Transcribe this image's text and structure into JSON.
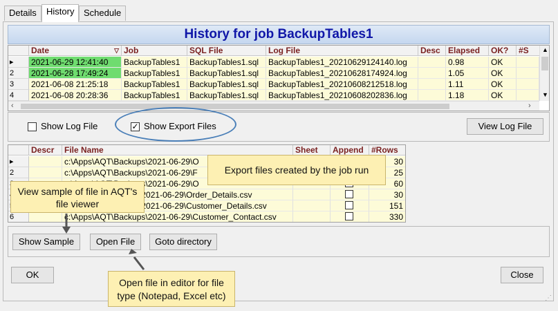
{
  "tabs": [
    "Details",
    "History",
    "Schedule"
  ],
  "title": "History for job BackupTables1",
  "history": {
    "columns": [
      "Date",
      "Job",
      "SQL File",
      "Log File",
      "Desc",
      "Elapsed",
      "OK?",
      "#S"
    ],
    "rows": [
      {
        "ind": "▸",
        "date": "2021-06-29 12:41:40",
        "job": "BackupTables1",
        "sql": "BackupTables1.sql",
        "log": "BackupTables1_20210629124140.log",
        "desc": "",
        "elapsed": "0.98",
        "ok": "OK",
        "hl": true
      },
      {
        "ind": "2",
        "date": "2021-06-28 17:49:24",
        "job": "BackupTables1",
        "sql": "BackupTables1.sql",
        "log": "BackupTables1_20210628174924.log",
        "desc": "",
        "elapsed": "1.05",
        "ok": "OK",
        "hl": true
      },
      {
        "ind": "3",
        "date": "2021-06-08 21:25:18",
        "job": "BackupTables1",
        "sql": "BackupTables1.sql",
        "log": "BackupTables1_20210608212518.log",
        "desc": "",
        "elapsed": "1.11",
        "ok": "OK",
        "hl": false
      },
      {
        "ind": "4",
        "date": "2021-06-08 20:28:36",
        "job": "BackupTables1",
        "sql": "BackupTables1.sql",
        "log": "BackupTables1_20210608202836.log",
        "desc": "",
        "elapsed": "1.18",
        "ok": "OK",
        "hl": false
      }
    ]
  },
  "show_log_file": {
    "label": "Show Log File",
    "checked": false
  },
  "show_export_files": {
    "label": "Show Export Files",
    "checked": true
  },
  "view_log_file_label": "View Log File",
  "exports": {
    "columns": [
      "Descr",
      "File Name",
      "Sheet",
      "Append",
      "#Rows"
    ],
    "rows": [
      {
        "ind": "▸",
        "file": "c:\\Apps\\AQT\\Backups\\2021-06-29\\O",
        "rows": "30"
      },
      {
        "ind": "2",
        "file": "c:\\Apps\\AQT\\Backups\\2021-06-29\\F",
        "rows": "25"
      },
      {
        "ind": "3",
        "file": "c:\\Apps\\AQT\\Backups\\2021-06-29\\O",
        "rows": "60"
      },
      {
        "ind": "4",
        "file": "\\Apps\\AQT\\Backups\\2021-06-29\\Order_Details.csv",
        "rows": "30"
      },
      {
        "ind": "5",
        "file": "\\Apps\\AQT\\Backups\\2021-06-29\\Customer_Details.csv",
        "rows": "151"
      },
      {
        "ind": "6",
        "file": "c:\\Apps\\AQT\\Backups\\2021-06-29\\Customer_Contact.csv",
        "rows": "330"
      }
    ]
  },
  "buttons": {
    "show_sample": "Show Sample",
    "open_file": "Open File",
    "goto_directory": "Goto directory",
    "ok": "OK",
    "close": "Close"
  },
  "callouts": {
    "export_files": "Export files created by the job run",
    "view_sample": "View sample of file in AQT's file viewer",
    "open_file": "Open file in editor for file type (Notepad, Excel etc)"
  },
  "colors": {
    "highlight_green": "#6fdc6f",
    "row_yellow": "#fdfbd8",
    "header_text": "#7a2222",
    "title_text": "#1017a8"
  }
}
